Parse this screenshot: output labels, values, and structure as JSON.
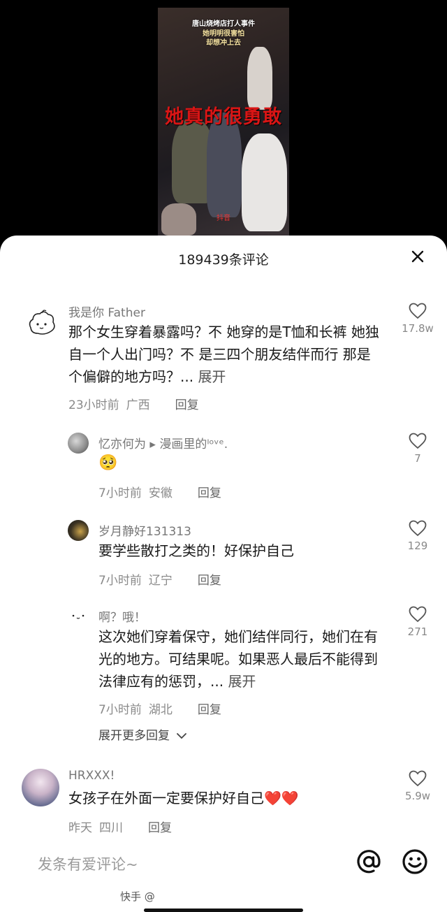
{
  "video": {
    "caption_line1": "唐山烧烤店打人事件",
    "caption_line2": "她明明很害怕",
    "caption_line3": "却想冲上去",
    "big_text": "她真的很勇敢",
    "small_text": "抖音"
  },
  "panel": {
    "title": "189439条评论",
    "close_icon": "close-icon"
  },
  "comments": [
    {
      "username": "我是你 Father",
      "text": "那个女生穿着暴露吗？不 她穿的是T恤和长裤 她独自一个人出门吗？不 是三四个朋友结伴而行 那是个偏僻的地方吗？... ",
      "expand": "展开",
      "time": "23小时前",
      "location": "广西",
      "reply": "回复",
      "likes": "17.8w"
    },
    {
      "username": "忆亦何为 ▸ 漫画里的ᴵᵒᵛᵉ.",
      "text": "🥺",
      "time": "7小时前",
      "location": "安徽",
      "reply": "回复",
      "likes": "7"
    },
    {
      "username": "岁月静好131313",
      "text": "要学些散打之类的！好保护自己",
      "time": "7小时前",
      "location": "辽宁",
      "reply": "回复",
      "likes": "129"
    },
    {
      "username": "啊？哦！",
      "text": "这次她们穿着保守，她们结伴同行，她们在有光的地方。可结果呢。如果恶人最后不能得到法律应有的惩罚，... ",
      "expand": "展开",
      "time": "7小时前",
      "location": "湖北",
      "reply": "回复",
      "likes": "271"
    },
    {
      "username": "HRXXX!",
      "text": "女孩子在外面一定要保护好自己❤️❤️",
      "time": "昨天",
      "location": "四川",
      "reply": "回复",
      "likes": "5.9w"
    }
  ],
  "more_replies": "展开更多回复",
  "input": {
    "placeholder": "发条有爱评论~"
  },
  "watermark": "快手 @"
}
